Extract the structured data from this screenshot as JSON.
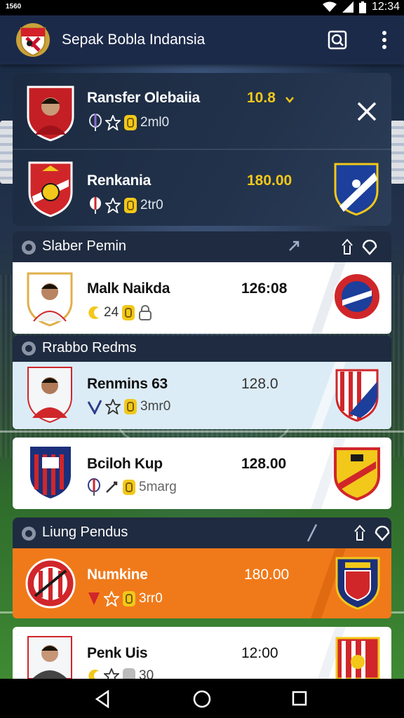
{
  "status_bar": {
    "left_text": "1560",
    "time": "12:34"
  },
  "app_bar": {
    "title": "Sepak Bobla Indansia",
    "icons": [
      "app-logo",
      "search-icon",
      "more-vert-icon"
    ]
  },
  "featured": {
    "rows": [
      {
        "name": "Ransfer Olebaiia",
        "value": "10.8",
        "meta": "2ml0"
      },
      {
        "name": "Renkania",
        "value": "180.00",
        "meta": "2tr0"
      }
    ]
  },
  "sections": [
    {
      "title": "Slaber Pemin",
      "rows": [
        {
          "name": "Malk Naikda",
          "value": "126:08",
          "meta_a": "24",
          "meta_b": ""
        }
      ]
    },
    {
      "title": "Rrabbo Redms",
      "rows": [
        {
          "name": "Renmins 63",
          "value": "128.0",
          "meta": "3mr0"
        }
      ]
    },
    {
      "title": "",
      "rows": [
        {
          "name": "Bciloh Kup",
          "value": "128.00",
          "meta": "5marg"
        }
      ]
    },
    {
      "title": "Liung Pendus",
      "rows": [
        {
          "name": "Numkine",
          "value": "180.00",
          "meta": "3rr0"
        },
        {
          "name": "Penk Uis",
          "value": "12:00",
          "meta": "30"
        }
      ]
    }
  ],
  "colors": {
    "accent_gold": "#f2c81a",
    "orange": "#f07a1a",
    "dark_card": "#1f2b40",
    "light_blue": "#dcecf6"
  }
}
